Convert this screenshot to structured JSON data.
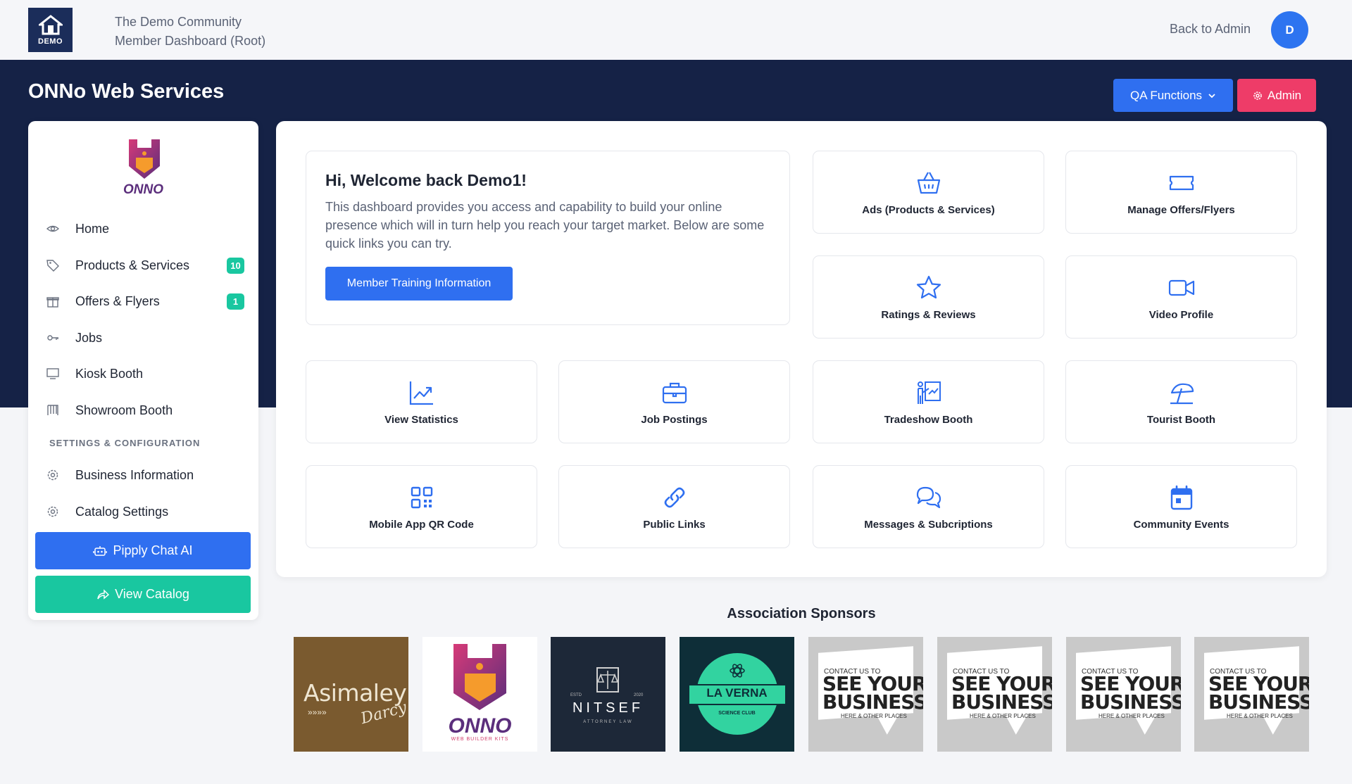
{
  "header": {
    "logo_text": "DEMO",
    "community_name": "The Demo Community",
    "dashboard_name": "Member Dashboard (Root)",
    "back_to_admin": "Back to Admin",
    "avatar_initial": "D"
  },
  "page": {
    "title": "ONNo Web Services",
    "qa_functions": "QA Functions",
    "admin": "Admin"
  },
  "sidebar": {
    "logo_text": "ONNO",
    "items": [
      {
        "label": "Home",
        "icon": "eye-icon"
      },
      {
        "label": "Products & Services",
        "icon": "tag-icon",
        "badge": "10"
      },
      {
        "label": "Offers & Flyers",
        "icon": "gift-icon",
        "badge": "1"
      },
      {
        "label": "Jobs",
        "icon": "key-icon"
      },
      {
        "label": "Kiosk Booth",
        "icon": "monitor-icon"
      },
      {
        "label": "Showroom Booth",
        "icon": "booth-icon"
      }
    ],
    "section_label": "SETTINGS & CONFIGURATION",
    "settings_items": [
      {
        "label": "Business Information",
        "icon": "gear-icon"
      },
      {
        "label": "Catalog Settings",
        "icon": "gear-icon"
      }
    ],
    "pipply_button": "Pipply Chat AI",
    "catalog_button": "View Catalog"
  },
  "welcome": {
    "heading": "Hi, Welcome back Demo1!",
    "text": "This dashboard provides you access and capability to build your online presence which will in turn help you reach your target market. Below are some quick links you can try.",
    "button": "Member Training Information"
  },
  "tiles": [
    {
      "label": "Ads (Products & Services)",
      "icon": "basket-icon"
    },
    {
      "label": "Manage Offers/Flyers",
      "icon": "ticket-icon"
    },
    {
      "label": "Ratings & Reviews",
      "icon": "star-icon"
    },
    {
      "label": "Video Profile",
      "icon": "video-icon"
    },
    {
      "label": "View Statistics",
      "icon": "chart-icon"
    },
    {
      "label": "Job Postings",
      "icon": "briefcase-icon"
    },
    {
      "label": "Tradeshow Booth",
      "icon": "presentation-icon"
    },
    {
      "label": "Tourist Booth",
      "icon": "umbrella-icon"
    },
    {
      "label": "Mobile App QR Code",
      "icon": "qr-icon"
    },
    {
      "label": "Public Links",
      "icon": "link-icon"
    },
    {
      "label": "Messages & Subcriptions",
      "icon": "chat-icon"
    },
    {
      "label": "Community Events",
      "icon": "calendar-icon"
    }
  ],
  "sponsors": {
    "title": "Association Sponsors",
    "asimaley": {
      "name": "Asimaley",
      "script": "Darcy"
    },
    "onno": {
      "name": "ONNO",
      "sub": "WEB BUILDER KITS"
    },
    "nitsef": {
      "name": "NITSEF",
      "sub": "ATTORNEY LAW",
      "estd": "ESTD",
      "year": "2020"
    },
    "laverna": {
      "name": "LA VERNA",
      "sub": "SCIENCE CLUB"
    },
    "ad": {
      "line1": "CONTACT US TO",
      "line2": "SEE YOUR",
      "line3": "BUSINESS",
      "line4": "HERE & OTHER PLACES"
    }
  }
}
